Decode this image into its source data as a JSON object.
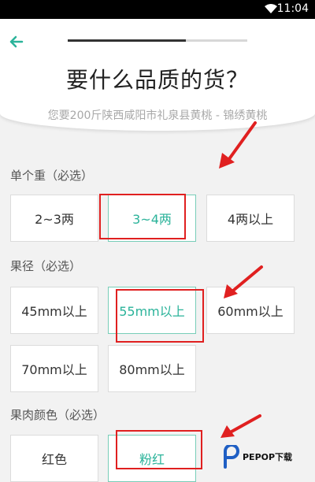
{
  "status": {
    "time": "11:04"
  },
  "header": {
    "title": "要什么品质的货？",
    "subtitle": "您要200斤陕西咸阳市礼泉县黄桃 - 锦绣黄桃",
    "progress": 0.66
  },
  "sections": [
    {
      "label": "单个重（必选）",
      "options": [
        "2~3两",
        "3~4两",
        "4两以上"
      ],
      "selected": 1
    },
    {
      "label": "果径（必选）",
      "options": [
        "45mm以上",
        "55mm以上",
        "60mm以上",
        "70mm以上",
        "80mm以上"
      ],
      "selected": 1
    },
    {
      "label": "果肉颜色（必选）",
      "options": [
        "红色",
        "粉红"
      ],
      "selected": 1
    }
  ],
  "watermark": {
    "text": "PEPOP下载"
  },
  "colors": {
    "accent": "#2bb39a",
    "annotation": "#e02020"
  }
}
